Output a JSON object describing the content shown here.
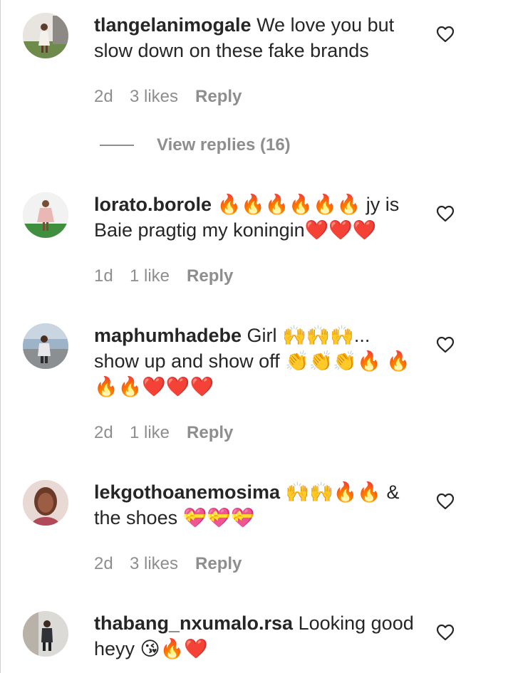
{
  "comments": [
    {
      "username": "tlangelanimogale",
      "text": " We love you but slow down on these fake brands",
      "time": "2d",
      "likes": "3 likes",
      "reply": "Reply"
    },
    {
      "username": "lorato.borole",
      "text": " 🔥🔥🔥🔥🔥🔥 jy is Baie pragtig my koningin❤️❤️❤️",
      "time": "1d",
      "likes": "1 like",
      "reply": "Reply"
    },
    {
      "username": "maphumhadebe",
      "text": " Girl 🙌🙌🙌... show up and show off 👏👏👏🔥 🔥🔥🔥❤️❤️❤️",
      "time": "2d",
      "likes": "1 like",
      "reply": "Reply"
    },
    {
      "username": "lekgothoanemosima",
      "text": " 🙌🙌🔥🔥 & the shoes 💝💝💝",
      "time": "2d",
      "likes": "3 likes",
      "reply": "Reply"
    },
    {
      "username": "thabang_nxumalo.rsa",
      "text": " Looking good heyy 😘🔥❤️",
      "time": "",
      "likes": "",
      "reply": ""
    }
  ],
  "view_replies": "View replies (16)",
  "icons": {
    "like": "heart-outline-icon"
  },
  "colors": {
    "text": "#262626",
    "secondary": "#8e8e8e",
    "background": "#ffffff"
  }
}
